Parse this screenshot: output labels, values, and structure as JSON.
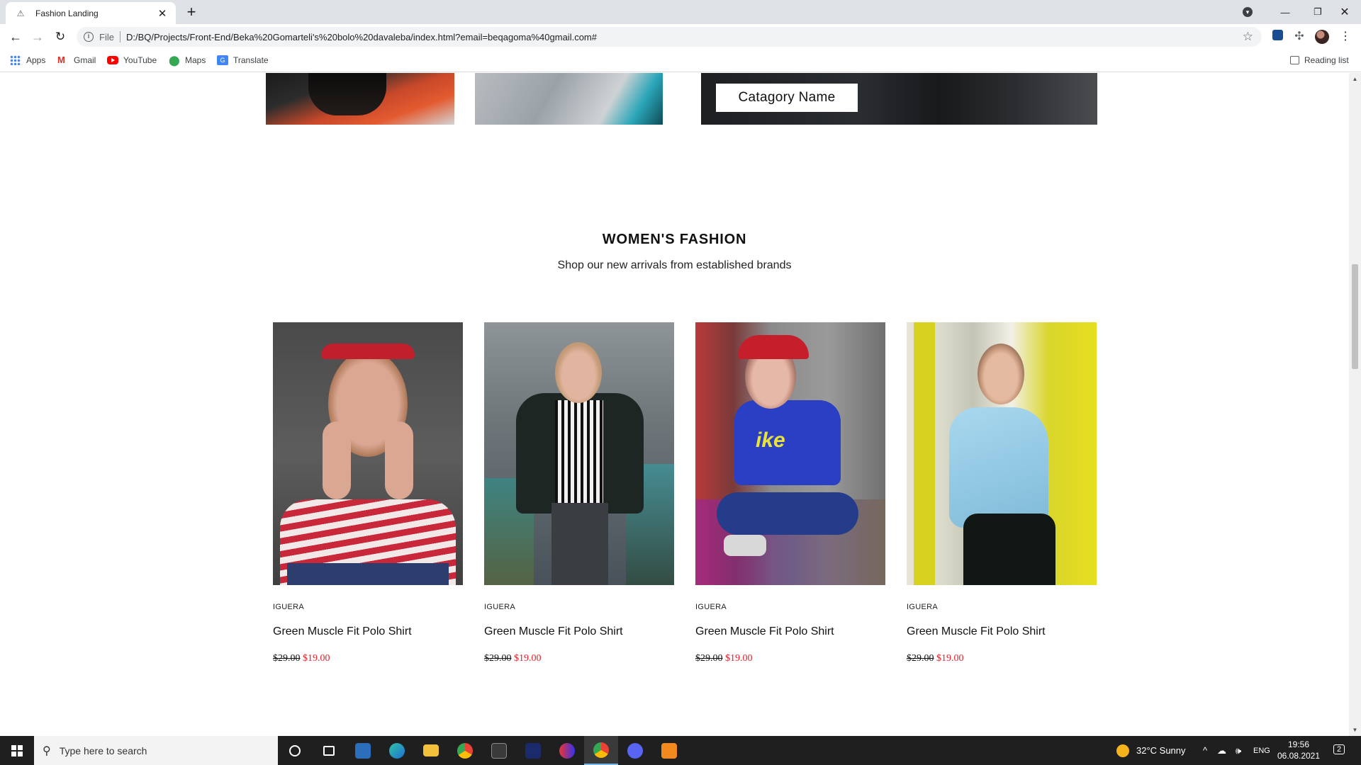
{
  "browser": {
    "tab_title": "Fashion Landing",
    "new_tab_label": "+",
    "close_tab_label": "✕",
    "url_scheme_label": "File",
    "url": "D:/BQ/Projects/Front-End/Beka%20Gomarteli's%20bolo%20davaleba/index.html?email=beqagoma%40gmail.com#",
    "bookmarks": [
      {
        "label": "Apps",
        "icon": "apps-grid-icon"
      },
      {
        "label": "Gmail",
        "icon": "gmail-icon"
      },
      {
        "label": "YouTube",
        "icon": "youtube-icon"
      },
      {
        "label": "Maps",
        "icon": "maps-pin-icon"
      },
      {
        "label": "Translate",
        "icon": "translate-icon"
      }
    ],
    "reading_list_label": "Reading list"
  },
  "page": {
    "category_label": "Catagory Name",
    "section_title": "WOMEN'S FASHION",
    "section_subtitle": "Shop our new arrivals from established brands",
    "products": [
      {
        "brand": "IGUERA",
        "name": "Green Muscle Fit Polo Shirt",
        "price_old": "$29.00",
        "price_new": "$19.00"
      },
      {
        "brand": "IGUERA",
        "name": "Green Muscle Fit Polo Shirt",
        "price_old": "$29.00",
        "price_new": "$19.00"
      },
      {
        "brand": "IGUERA",
        "name": "Green Muscle Fit Polo Shirt",
        "price_old": "$29.00",
        "price_new": "$19.00"
      },
      {
        "brand": "IGUERA",
        "name": "Green Muscle Fit Polo Shirt",
        "price_old": "$29.00",
        "price_new": "$19.00"
      }
    ],
    "colors": {
      "price_new": "#e4202a",
      "text": "#111111"
    }
  },
  "taskbar": {
    "search_placeholder": "Type here to search",
    "weather": "32°C  Sunny",
    "language": "ENG",
    "time": "19:56",
    "date": "06.08.2021",
    "notification_count": "2"
  }
}
